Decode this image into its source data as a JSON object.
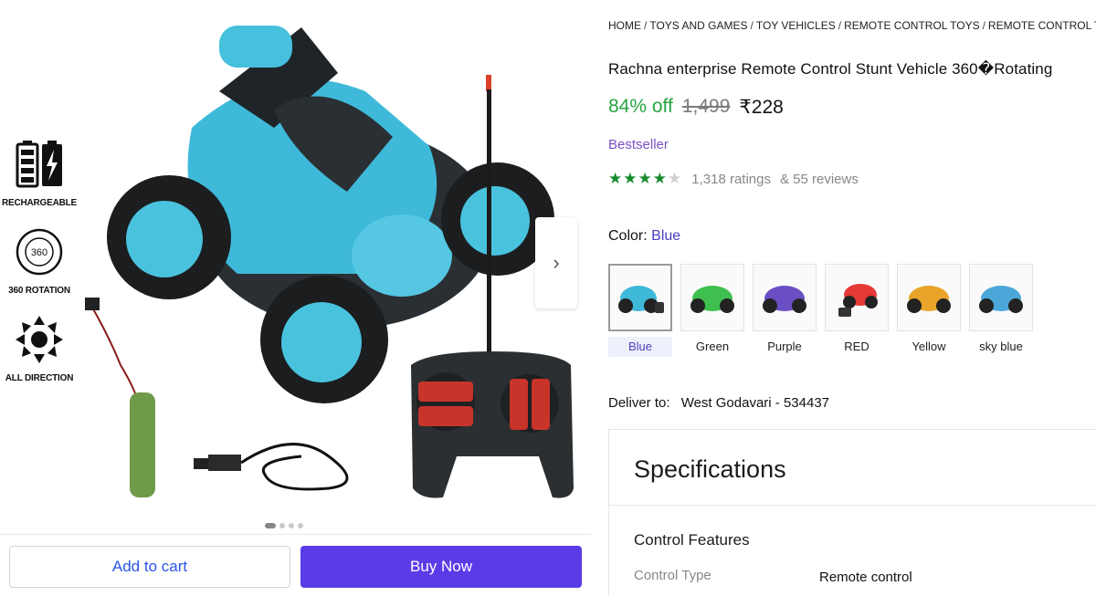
{
  "gallery": {
    "features": [
      {
        "label": "RECHARGEABLE",
        "icon": "battery-charge-icon"
      },
      {
        "label": "360 ROTATION",
        "icon": "rotation-360-icon",
        "badge": "360"
      },
      {
        "label": "ALL DIRECTION",
        "icon": "all-direction-icon"
      }
    ],
    "next_icon": "›",
    "dots": 4,
    "active_dot": 0
  },
  "actions": {
    "add_to_cart": "Add to cart",
    "buy_now": "Buy Now"
  },
  "breadcrumb": [
    "HOME",
    "TOYS AND GAMES",
    "TOY VEHICLES",
    "REMOTE CONTROL TOYS",
    "REMOTE CONTROL TOY V"
  ],
  "product": {
    "title": "Rachna enterprise Remote Control Stunt Vehicle 360�Rotating",
    "discount": "84% off",
    "mrp": "1,499",
    "price": "₹228",
    "badge": "Bestseller",
    "stars": 4,
    "ratings_text": "1,318 ratings",
    "reviews_text": "& 55 reviews"
  },
  "color": {
    "label": "Color:",
    "selected": "Blue",
    "options": [
      {
        "name": "Blue",
        "hex": "#3fb9d9"
      },
      {
        "name": "Green",
        "hex": "#3fbf4f"
      },
      {
        "name": "Purple",
        "hex": "#6a4fc4"
      },
      {
        "name": "RED",
        "hex": "#e53935"
      },
      {
        "name": "Yellow",
        "hex": "#e9a52a"
      },
      {
        "name": "sky blue",
        "hex": "#4aa7d8"
      }
    ]
  },
  "delivery": {
    "label": "Deliver to:",
    "location": "West Godavari - 534437"
  },
  "specs": {
    "title": "Specifications",
    "section": "Control Features",
    "key": "Control Type",
    "value": "Remote control"
  },
  "colors": {
    "accent": "#5b3be8",
    "link": "#2a55e5",
    "discount": "#26a541",
    "star": "#188a2c",
    "bestseller": "#7a4fc7"
  }
}
